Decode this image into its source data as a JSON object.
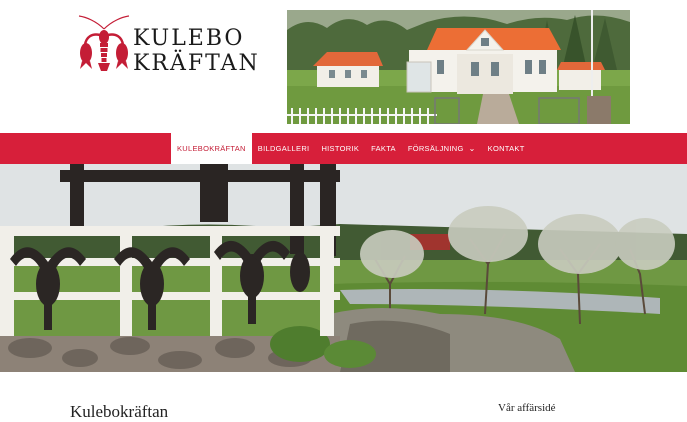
{
  "brand": {
    "line1": "KULEBO",
    "line2": "KRÄFTAN",
    "accent_color": "#d71f3a",
    "icon": "crayfish-logo-icon"
  },
  "nav": {
    "items": [
      {
        "label": "KULEBOKRÄFTAN",
        "active": true
      },
      {
        "label": "BILDGALLERI",
        "active": false
      },
      {
        "label": "HISTORIK",
        "active": false
      },
      {
        "label": "FAKTA",
        "active": false
      },
      {
        "label": "FÖRSÄLJNING",
        "active": false,
        "dropdown": true
      },
      {
        "label": "KONTAKT",
        "active": false
      }
    ],
    "chevron_icon": "chevron-down-icon"
  },
  "content": {
    "title": "Kulebokräftan",
    "sidebar_title": "Vår affärsidé"
  }
}
